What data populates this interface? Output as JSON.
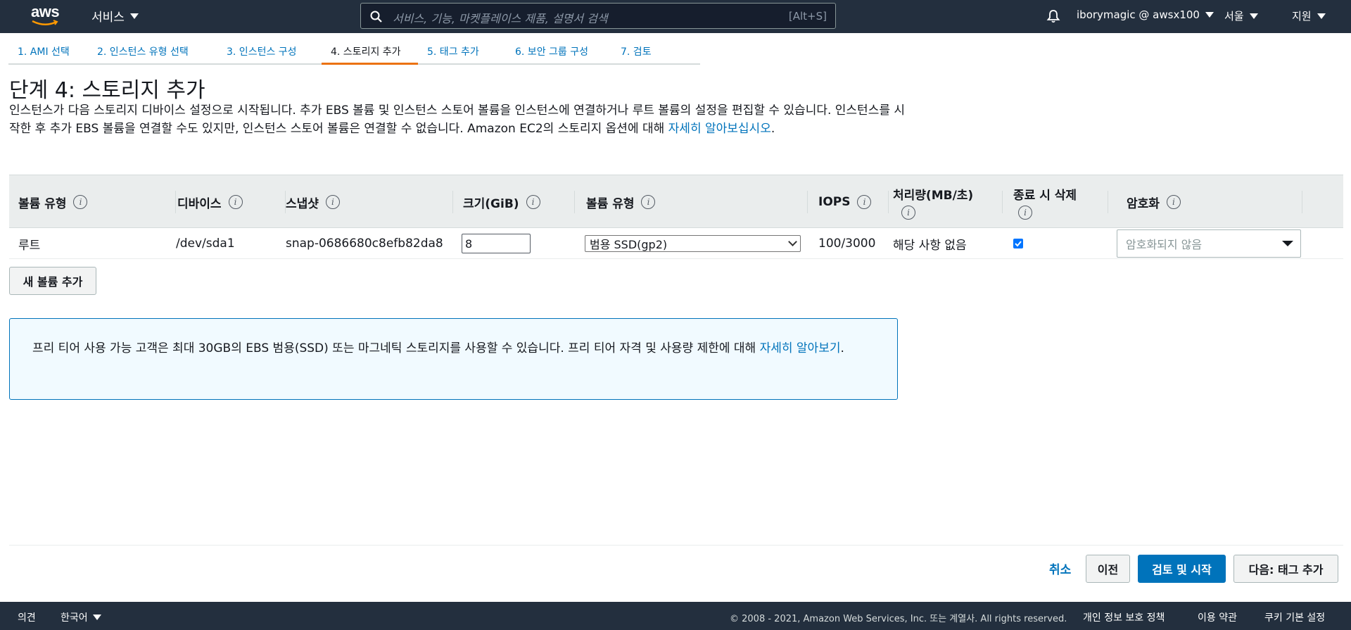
{
  "topnav": {
    "logo_text": "aws",
    "services_label": "서비스",
    "search_placeholder": "서비스, 기능, 마켓플레이스 제품, 설명서 검색",
    "search_shortcut": "[Alt+S]",
    "account_label": "iborymagic @ awsx100",
    "region_label": "서울",
    "support_label": "지원"
  },
  "tabs": [
    {
      "label": "1. AMI 선택"
    },
    {
      "label": "2. 인스턴스 유형 선택"
    },
    {
      "label": "3. 인스턴스 구성"
    },
    {
      "label": "4. 스토리지 추가"
    },
    {
      "label": "5. 태그 추가"
    },
    {
      "label": "6. 보안 그룹 구성"
    },
    {
      "label": "7. 검토"
    }
  ],
  "page": {
    "title": "단계 4: 스토리지 추가",
    "description": "인스턴스가 다음 스토리지 디바이스 설정으로 시작됩니다. 추가 EBS 볼륨 및 인스턴스 스토어 볼륨을 인스턴스에 연결하거나 루트 볼륨의 설정을 편집할 수 있습니다. 인스턴스를 시작한 후 추가 EBS 볼륨을 연결할 수도 있지만, 인스턴스 스토어 볼륨은 연결할 수 없습니다. Amazon EC2의 스토리지 옵션에 대해 ",
    "description_link": "자세히 알아보십시오",
    "description_end": "."
  },
  "table": {
    "headers": {
      "volume_type": "볼륨 유형",
      "device": "디바이스",
      "snapshot": "스냅샷",
      "size": "크기(GiB)",
      "ebs_type": "볼륨 유형",
      "iops": "IOPS",
      "throughput": "처리량(MB/초)",
      "delete_on_term": "종료 시 삭제",
      "encryption": "암호화"
    },
    "row": {
      "volume_type": "루트",
      "device": "/dev/sda1",
      "snapshot": "snap-0686680c8efb82da8",
      "size": "8",
      "ebs_type": "범용 SSD(gp2)",
      "iops": "100/3000",
      "throughput": "해당 사항 없음",
      "delete_on_term_checked": true,
      "encryption": "암호화되지 않음"
    },
    "add_volume_label": "새 볼륨 추가"
  },
  "notice": {
    "text": "프리 티어 사용 가능 고객은 최대 30GB의 EBS 범용(SSD) 또는 마그네틱 스토리지를 사용할 수 있습니다. 프리 티어 자격 및 사용량 제한에 대해 ",
    "link": "자세히 알아보기",
    "end": "."
  },
  "actions": {
    "cancel": "취소",
    "previous": "이전",
    "review_launch": "검토 및 시작",
    "next": "다음: 태그 추가"
  },
  "footer": {
    "feedback": "의견",
    "language": "한국어",
    "copyright": "© 2008 - 2021, Amazon Web Services, Inc. 또는 계열사. All rights reserved.",
    "privacy": "개인 정보 보호 정책",
    "terms": "이용 약관",
    "cookies": "쿠키 기본 설정"
  },
  "colors": {
    "nav_bg": "#232f3e",
    "link": "#0073bb",
    "active_tab": "#ec7211",
    "primary_button": "#0073bb",
    "notice_bg": "#f1faff"
  }
}
